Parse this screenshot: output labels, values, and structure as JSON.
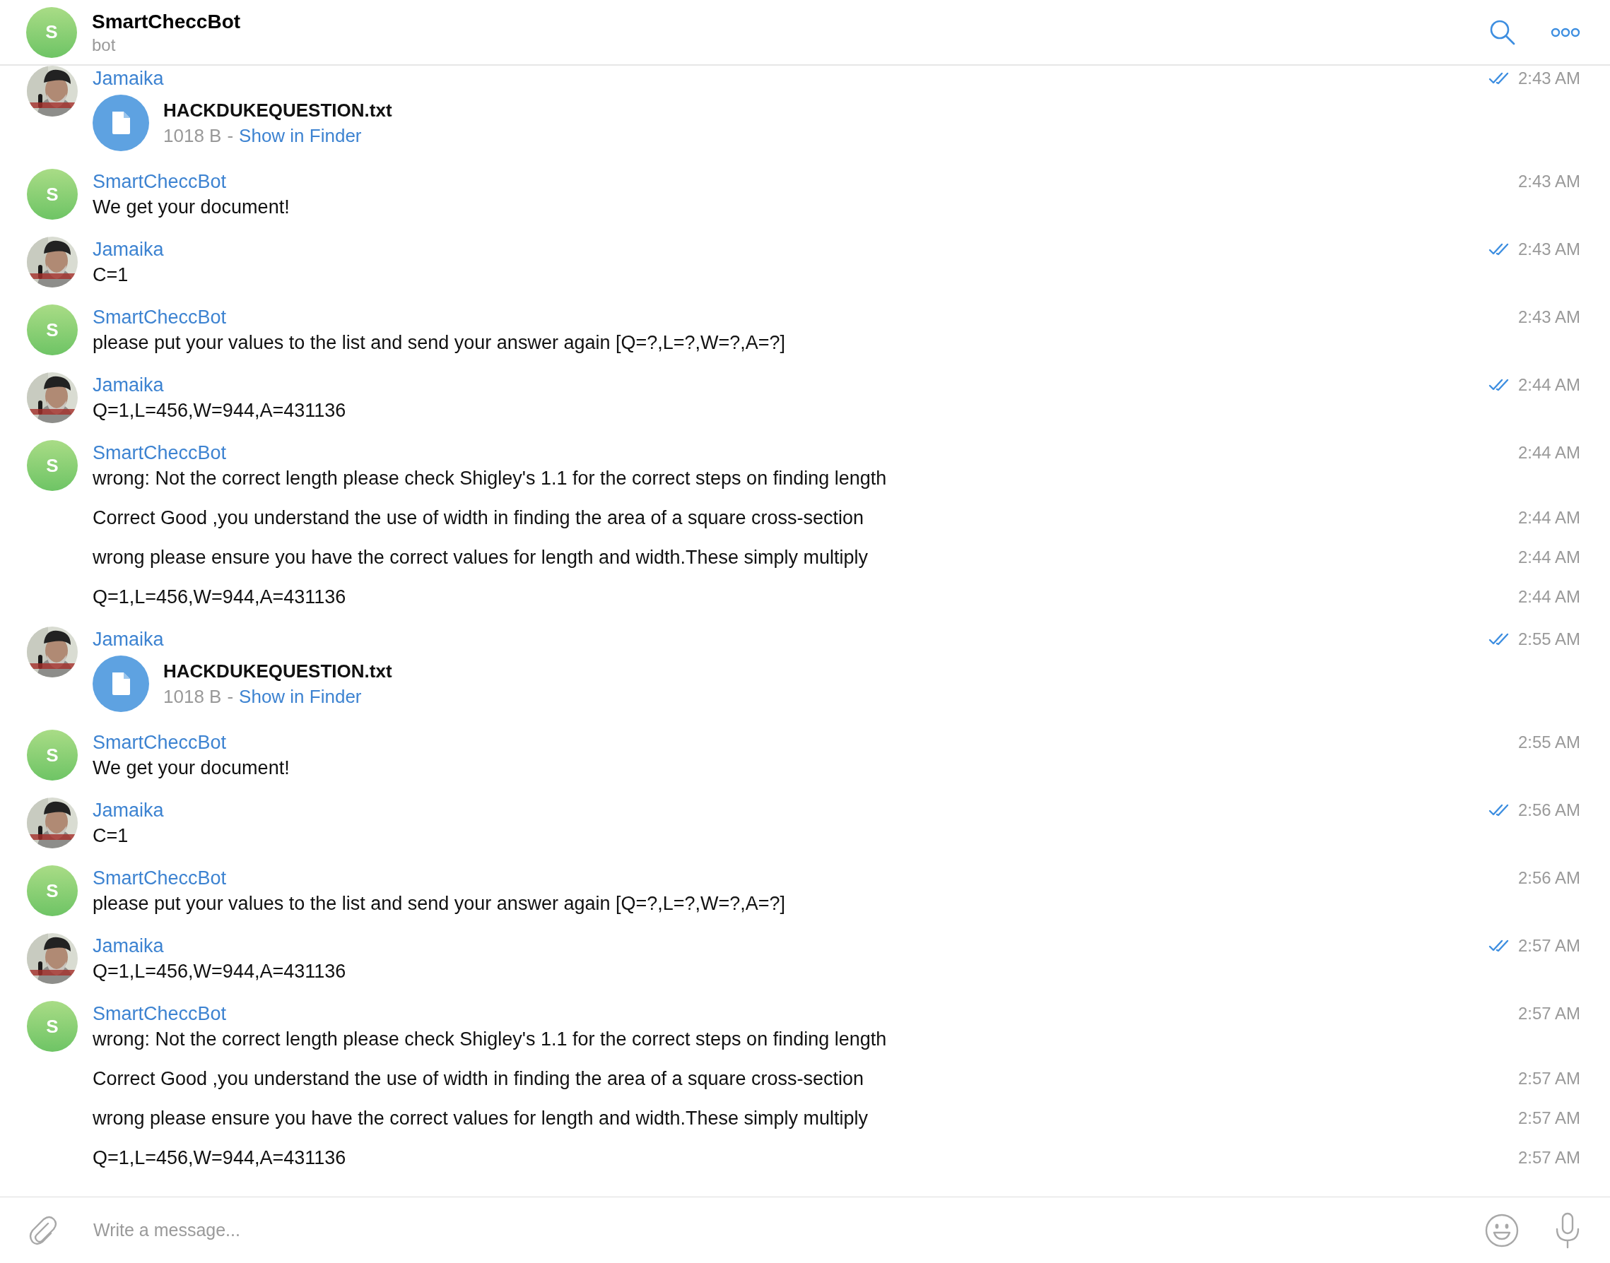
{
  "header": {
    "title": "SmartCheccBot",
    "subtitle": "bot",
    "avatar": {
      "kind": "letter",
      "initial": "S"
    }
  },
  "groups": [
    {
      "sender": "Jamaika",
      "messages": [
        {
          "kind": "file",
          "filename": "HACKDUKEQUESTION.txt",
          "size": "1018 B",
          "separator": "-",
          "action": "Show in Finder",
          "time": "2:43 AM",
          "read": true
        }
      ]
    },
    {
      "sender": "SmartCheccBot",
      "avatar": {
        "kind": "letter",
        "initial": "S"
      },
      "messages": [
        {
          "kind": "text",
          "text": "We get your document!",
          "time": "2:43 AM",
          "read": false
        }
      ]
    },
    {
      "sender": "Jamaika",
      "messages": [
        {
          "kind": "text",
          "text": "C=1",
          "time": "2:43 AM",
          "read": true
        }
      ]
    },
    {
      "sender": "SmartCheccBot",
      "avatar": {
        "kind": "letter",
        "initial": "S"
      },
      "messages": [
        {
          "kind": "text",
          "text": "please put your values to the list and send your answer again [Q=?,L=?,W=?,A=?]",
          "time": "2:43 AM",
          "read": false
        }
      ]
    },
    {
      "sender": "Jamaika",
      "messages": [
        {
          "kind": "text",
          "text": "Q=1,L=456,W=944,A=431136",
          "time": "2:44 AM",
          "read": true
        }
      ]
    },
    {
      "sender": "SmartCheccBot",
      "avatar": {
        "kind": "letter",
        "initial": "S"
      },
      "messages": [
        {
          "kind": "text",
          "text": "wrong: Not the correct length please check Shigley's 1.1 for the correct steps on finding length",
          "time": "2:44 AM",
          "read": false
        },
        {
          "kind": "text",
          "text": "Correct Good ,you understand the use of width in finding the area of a square cross-section",
          "time": "2:44 AM",
          "read": false
        },
        {
          "kind": "text",
          "text": "wrong please ensure you have the correct values for length and width.These simply multiply",
          "time": "2:44 AM",
          "read": false
        },
        {
          "kind": "text",
          "text": "Q=1,L=456,W=944,A=431136",
          "time": "2:44 AM",
          "read": false
        }
      ]
    },
    {
      "sender": "Jamaika",
      "messages": [
        {
          "kind": "file",
          "filename": "HACKDUKEQUESTION.txt",
          "size": "1018 B",
          "separator": "-",
          "action": "Show in Finder",
          "time": "2:55 AM",
          "read": true
        }
      ]
    },
    {
      "sender": "SmartCheccBot",
      "avatar": {
        "kind": "letter",
        "initial": "S"
      },
      "messages": [
        {
          "kind": "text",
          "text": "We get your document!",
          "time": "2:55 AM",
          "read": false
        }
      ]
    },
    {
      "sender": "Jamaika",
      "messages": [
        {
          "kind": "text",
          "text": "C=1",
          "time": "2:56 AM",
          "read": true
        }
      ]
    },
    {
      "sender": "SmartCheccBot",
      "avatar": {
        "kind": "letter",
        "initial": "S"
      },
      "messages": [
        {
          "kind": "text",
          "text": "please put your values to the list and send your answer again [Q=?,L=?,W=?,A=?]",
          "time": "2:56 AM",
          "read": false
        }
      ]
    },
    {
      "sender": "Jamaika",
      "messages": [
        {
          "kind": "text",
          "text": "Q=1,L=456,W=944,A=431136",
          "time": "2:57 AM",
          "read": true
        }
      ]
    },
    {
      "sender": "SmartCheccBot",
      "avatar": {
        "kind": "letter",
        "initial": "S"
      },
      "messages": [
        {
          "kind": "text",
          "text": "wrong: Not the correct length please check Shigley's 1.1 for the correct steps on finding length",
          "time": "2:57 AM",
          "read": false
        },
        {
          "kind": "text",
          "text": "Correct Good ,you understand the use of width in finding the area of a square cross-section",
          "time": "2:57 AM",
          "read": false
        },
        {
          "kind": "text",
          "text": "wrong please ensure you have the correct values for length and width.These simply multiply",
          "time": "2:57 AM",
          "read": false
        },
        {
          "kind": "text",
          "text": "Q=1,L=456,W=944,A=431136",
          "time": "2:57 AM",
          "read": false
        }
      ]
    }
  ],
  "composer": {
    "placeholder": "Write a message..."
  }
}
